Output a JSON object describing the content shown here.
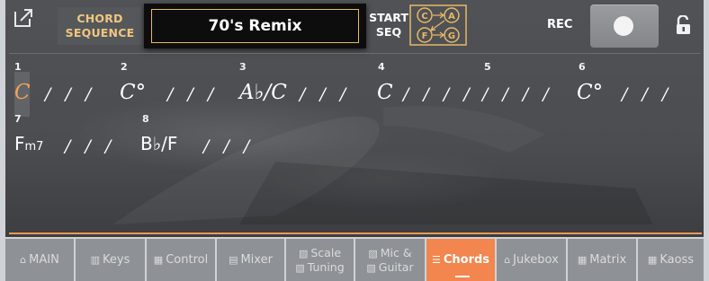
{
  "header": {
    "chord_sequence_label_line1": "CHORD",
    "chord_sequence_label_line2": "SEQUENCE",
    "sequence_name": "70's Remix",
    "start_seq_line1": "START",
    "start_seq_line2": "SEQ",
    "start_mode_nodes": [
      "C",
      "A",
      "F",
      "G"
    ],
    "rec_label": "REC"
  },
  "sequence": {
    "measures": [
      {
        "number": "1",
        "chord_root": "C",
        "chord_suffix": "",
        "slashes": "/ / /"
      },
      {
        "number": "2",
        "chord_root": "C",
        "chord_suffix": "°",
        "slashes": "/ / /"
      },
      {
        "number": "3",
        "chord_root": "A",
        "chord_suffix": "♭/C",
        "slashes": "/ / /"
      },
      {
        "number": "4",
        "chord_root": "C",
        "chord_suffix": "",
        "slashes": "/ / / /"
      },
      {
        "number": "5",
        "chord_root": "",
        "chord_suffix": "",
        "slashes": "/ / / /"
      },
      {
        "number": "6",
        "chord_root": "C",
        "chord_suffix": "°",
        "slashes": "/ / /"
      },
      {
        "number": "7",
        "chord_root": "F",
        "chord_suffix": "m7",
        "slashes": "/ / /"
      },
      {
        "number": "8",
        "chord_root": "B",
        "chord_suffix": "♭/F",
        "slashes": "/ / /"
      }
    ]
  },
  "tabs": [
    {
      "label": "MAIN",
      "icon": "home-icon",
      "active": false
    },
    {
      "label": "Keys",
      "icon": "keys-icon",
      "active": false
    },
    {
      "label": "Control",
      "icon": "control-icon",
      "active": false
    },
    {
      "label_line1": "Scale",
      "label_line2": "Tuning",
      "icon": "scale-icon",
      "active": false
    },
    {
      "label": "Mixer",
      "icon": "mixer-icon",
      "active": false
    },
    {
      "label_line1": "Mic &",
      "label_line2": "Guitar",
      "icon": "mic-icon",
      "active": false
    },
    {
      "label": "Chords",
      "icon": "chords-icon",
      "active": true
    },
    {
      "label": "Jukebox",
      "icon": "jukebox-icon",
      "active": false
    },
    {
      "label": "Matrix",
      "icon": "matrix-icon",
      "active": false
    },
    {
      "label": "Kaoss",
      "icon": "kaoss-icon",
      "active": false
    }
  ],
  "colors": {
    "accent": "#f2864e",
    "chord_label": "#f1c67f",
    "selected_chord": "#f1a25a"
  }
}
